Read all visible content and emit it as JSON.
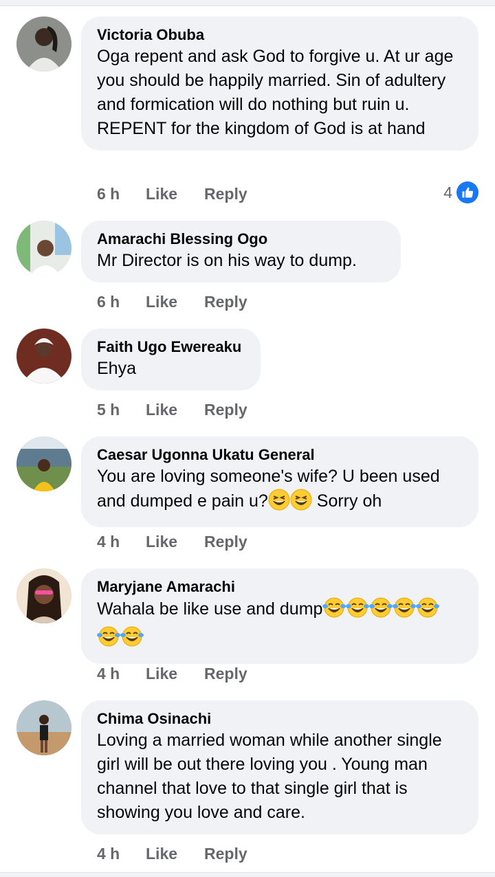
{
  "comments": [
    {
      "name": "Victoria Obuba",
      "text": "Oga repent and ask God to forgive u. At ur age you should be happily married. Sin of adultery and formication will do nothing but ruin u. REPENT for the kingdom of God is at hand",
      "time": "6 h",
      "like": "Like",
      "reply": "Reply",
      "reactions": "4"
    },
    {
      "name": "Amarachi Blessing Ogo",
      "text": "Mr Director is on his way to dump.",
      "time": "6 h",
      "like": "Like",
      "reply": "Reply"
    },
    {
      "name": "Faith Ugo Ewereaku",
      "text": "Ehya",
      "time": "5 h",
      "like": "Like",
      "reply": "Reply"
    },
    {
      "name": "Caesar Ugonna Ukatu General",
      "text_a": "You are loving someone's wife? U been used and dumped e pain u?",
      "text_b": " Sorry oh",
      "time": "4 h",
      "like": "Like",
      "reply": "Reply"
    },
    {
      "name": "Maryjane Amarachi",
      "text": "Wahala be like use and dump",
      "time": "4 h",
      "like": "Like",
      "reply": "Reply"
    },
    {
      "name": "Chima Osinachi",
      "text": "Loving a married woman while another single girl will be out there loving you . Young man channel that love to that single girl that is showing you love and care.",
      "time": "4 h",
      "like": "Like",
      "reply": "Reply"
    }
  ],
  "icons": {
    "reaction": "like-thumb-icon",
    "grin": "grinning-squinting-face-emoji",
    "tears": "face-with-tears-of-joy-emoji"
  },
  "colors": {
    "bubble": "#f0f2f5",
    "meta": "#65676b",
    "like_blue": "#1877f2"
  }
}
